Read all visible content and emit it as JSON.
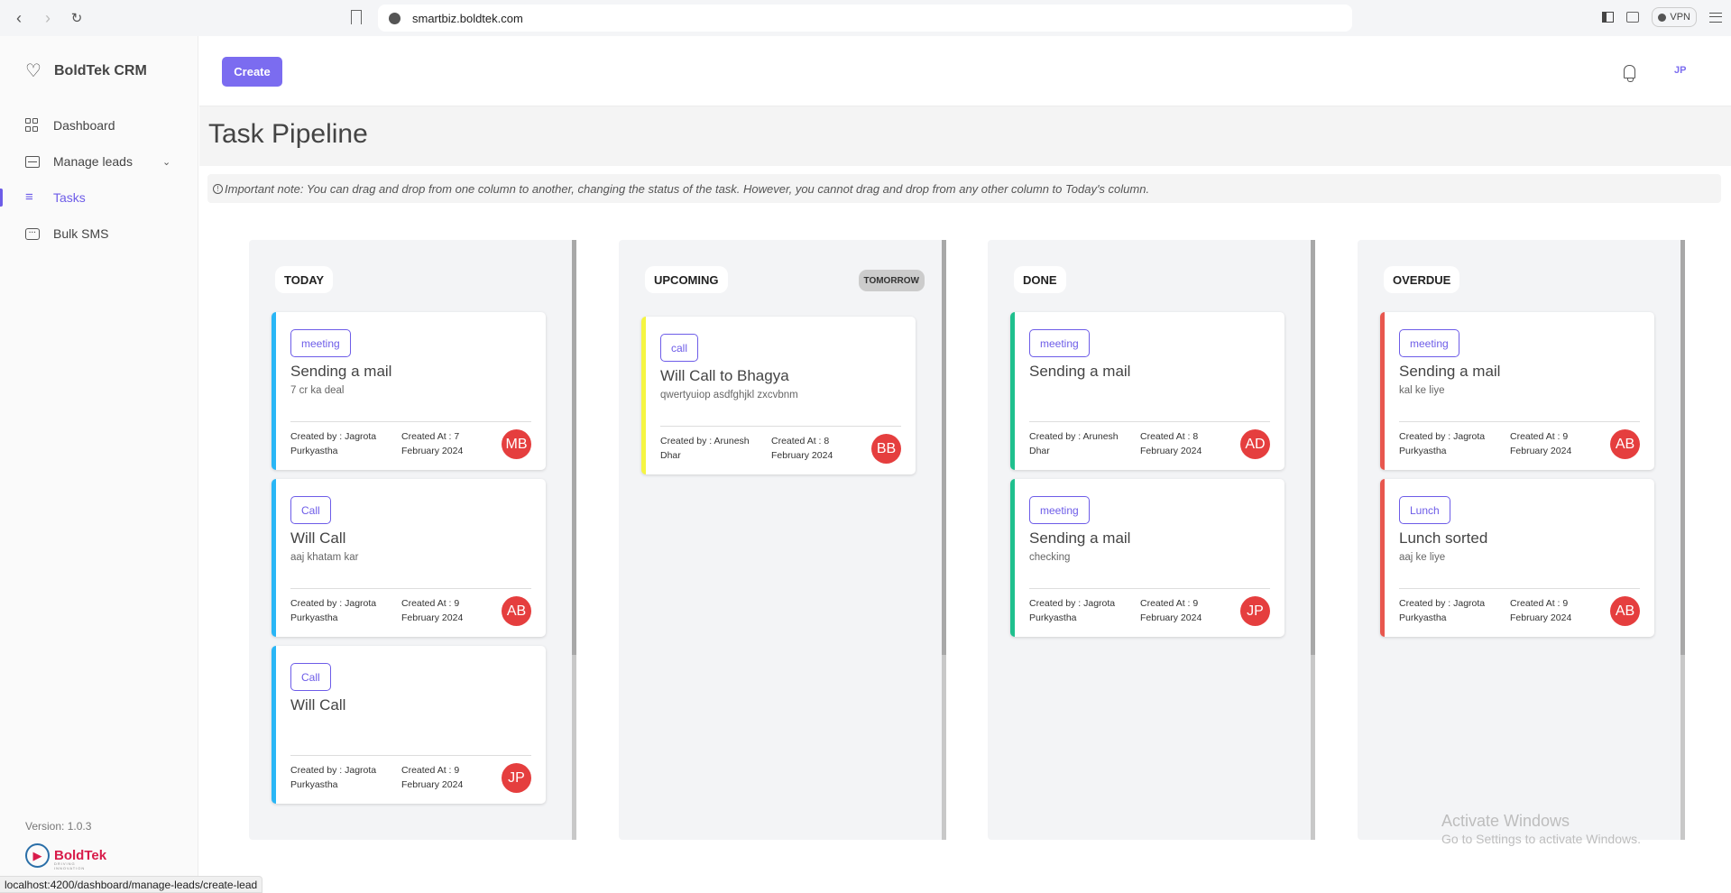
{
  "browser": {
    "url": "smartbiz.boldtek.com",
    "vpn_label": "VPN",
    "status_url": "localhost:4200/dashboard/manage-leads/create-lead"
  },
  "sidebar": {
    "brand": "BoldTek CRM",
    "items": [
      {
        "label": "Dashboard",
        "icon": "dashboard-grid-icon"
      },
      {
        "label": "Manage leads",
        "icon": "inbox-tray-icon",
        "has_dropdown": true
      },
      {
        "label": "Tasks",
        "icon": "layers-stack-icon",
        "active": true
      },
      {
        "label": "Bulk SMS",
        "icon": "chat-bubble-icon"
      }
    ],
    "version": "Version: 1.0.3",
    "footer_logo": "BoldTek",
    "footer_tagline": "DRIVING INNOVATION"
  },
  "header": {
    "create_label": "Create",
    "user_initials": "JP"
  },
  "page": {
    "title": "Task Pipeline",
    "note": "Important note: You can drag and drop from one column to another, changing the status of the task. However, you cannot drag and drop from any other column to Today's column."
  },
  "colors": {
    "accent": "#7b6cf0",
    "today": "#29b6f6",
    "upcoming": "#f5f542",
    "done": "#1fc08e",
    "overdue": "#e8574e",
    "avatar": "#e53e3e"
  },
  "columns": [
    {
      "title": "TODAY",
      "badge": null,
      "cards": [
        {
          "tag": "meeting",
          "title": "Sending a mail",
          "desc": "7 cr ka deal",
          "created_by": "Created by : Jagrota Purkyastha",
          "created_at": "Created At : 7 February 2024",
          "avatar": "MB"
        },
        {
          "tag": "Call",
          "title": "Will Call",
          "desc": "aaj khatam kar",
          "created_by": "Created by : Jagrota Purkyastha",
          "created_at": "Created At : 9 February 2024",
          "avatar": "AB"
        },
        {
          "tag": "Call",
          "title": "Will Call",
          "desc": "",
          "created_by": "Created by : Jagrota Purkyastha",
          "created_at": "Created At : 9 February 2024",
          "avatar": "JP"
        }
      ]
    },
    {
      "title": "UPCOMING",
      "badge": "TOMORROW",
      "cards": [
        {
          "tag": "call",
          "title": "Will Call to Bhagya",
          "desc": "qwertyuiop asdfghjkl zxcvbnm",
          "created_by": "Created by : Arunesh Dhar",
          "created_at": "Created At : 8 February 2024",
          "avatar": "BB"
        }
      ]
    },
    {
      "title": "DONE",
      "badge": null,
      "cards": [
        {
          "tag": "meeting",
          "title": "Sending a mail",
          "desc": "",
          "created_by": "Created by : Arunesh Dhar",
          "created_at": "Created At : 8 February 2024",
          "avatar": "AD"
        },
        {
          "tag": "meeting",
          "title": "Sending a mail",
          "desc": "checking",
          "created_by": "Created by : Jagrota Purkyastha",
          "created_at": "Created At : 9 February 2024",
          "avatar": "JP"
        }
      ]
    },
    {
      "title": "OVERDUE",
      "badge": null,
      "cards": [
        {
          "tag": "meeting",
          "title": "Sending a mail",
          "desc": "kal ke liye",
          "created_by": "Created by : Jagrota Purkyastha",
          "created_at": "Created At : 9 February 2024",
          "avatar": "AB"
        },
        {
          "tag": "Lunch",
          "title": "Lunch sorted",
          "desc": "aaj ke liye",
          "created_by": "Created by : Jagrota Purkyastha",
          "created_at": "Created At : 9 February 2024",
          "avatar": "AB"
        }
      ]
    }
  ],
  "watermark": {
    "line1": "Activate Windows",
    "line2": "Go to Settings to activate Windows."
  }
}
